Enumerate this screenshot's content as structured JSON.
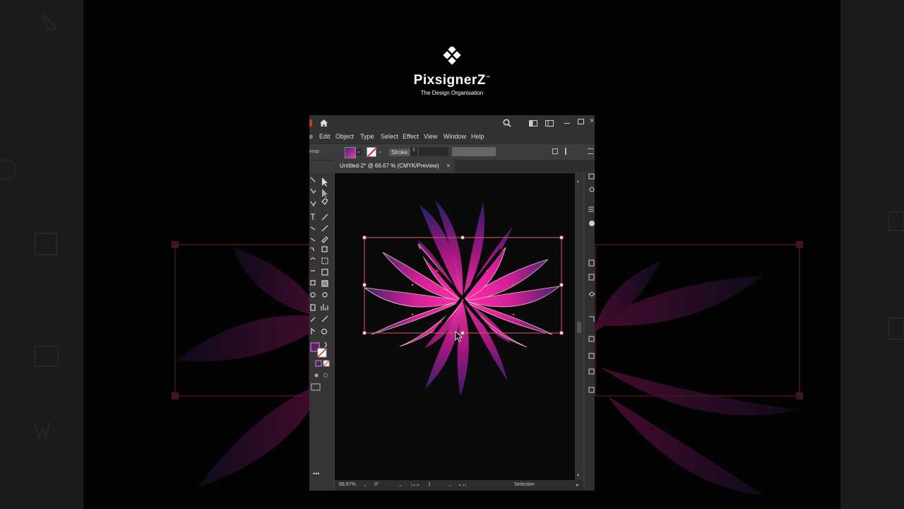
{
  "logo": {
    "brand": "PixsignerZ",
    "tm": "™",
    "tagline": "The Design Organisation"
  },
  "menu": [
    "e",
    "Edit",
    "Object",
    "Type",
    "Select",
    "Effect",
    "View",
    "Window",
    "Help"
  ],
  "control_bar": {
    "selection_label": "roup",
    "stroke_label": "Stroke:",
    "stroke_value": ""
  },
  "document_tab": {
    "title": "Untitled-2* @ 66.67 % (CMYK/Preview)",
    "close": "×"
  },
  "status_bar": {
    "zoom": "66.67%",
    "rotation": "0°",
    "artboard": "1",
    "tool": "Selection"
  },
  "colors": {
    "accent_pink": "#ff2fa8",
    "petal_purple": "#3a2a78",
    "selection_red": "#e0556a"
  },
  "icons": [
    "home-icon",
    "search-icon",
    "arrange-icon",
    "layout-icon",
    "minimize-icon",
    "maximize-icon",
    "close-icon",
    "selection-tool-icon",
    "direct-selection-icon",
    "fill-swatch-icon",
    "stroke-swatch-icon",
    "more-tools-icon"
  ]
}
